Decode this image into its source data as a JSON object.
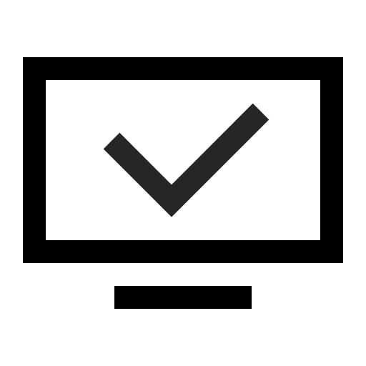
{
  "icon": {
    "name": "monitor-check-icon",
    "colors": {
      "background": "#ffffff",
      "frame": "#000000",
      "checkmark": "#262626",
      "stand": "#000000"
    }
  }
}
